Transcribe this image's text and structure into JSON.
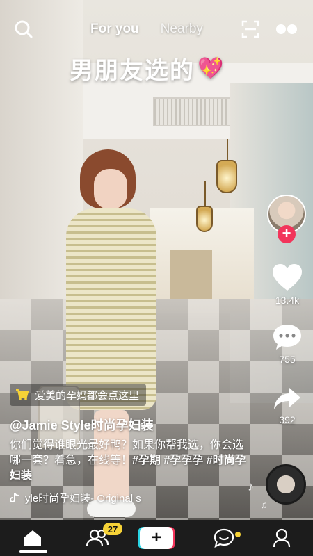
{
  "top_bar": {
    "tabs": [
      {
        "label": "For you",
        "active": true
      },
      {
        "label": "Nearby",
        "active": false
      }
    ],
    "icons": {
      "search": "search-icon",
      "scan": "scan-icon",
      "live": "live-dots-icon"
    }
  },
  "video": {
    "overlay_caption": "男朋友选的",
    "overlay_emoji": "💖"
  },
  "creator": {
    "follow_symbol": "+"
  },
  "actions": {
    "likes": "13.4k",
    "comments": "755",
    "shares": "392"
  },
  "post": {
    "shop_tag": "爱美的孕妈都会点这里",
    "username": "@Jamie Style时尚孕妇装",
    "description": "你们觉得谁眼光最好鸭？如果你帮我选，你会选哪一套？着急，在线等！",
    "hashtags": "#孕期 #孕孕孕 #时尚孕妇装",
    "music": "yle时尚孕妇装- Original s",
    "music_icon": "tiktok-note-icon"
  },
  "bottom_nav": {
    "items": [
      "home-icon",
      "friends-icon",
      "create-icon",
      "inbox-icon",
      "profile-icon"
    ],
    "friends_badge": "27",
    "create_symbol": "+"
  },
  "colors": {
    "follow_red": "#f2345a",
    "badge_yellow": "#f6d237",
    "cyan_accent": "#29d5e5"
  }
}
